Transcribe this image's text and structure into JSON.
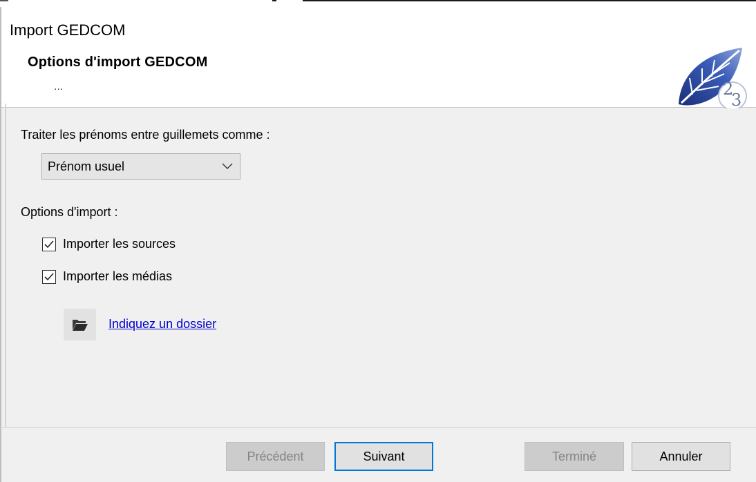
{
  "window": {
    "title": "Import GEDCOM"
  },
  "header": {
    "title": "Options d'import GEDCOM",
    "subtitle": "...",
    "logo_icon": "leaf-23-logo-icon"
  },
  "first_names": {
    "label": "Traiter les prénoms entre guillemets comme :",
    "selected": "Prénom usuel"
  },
  "import_options": {
    "label": "Options d'import :",
    "sources": {
      "label": "Importer les sources",
      "checked": true
    },
    "media": {
      "label": "Importer les médias",
      "checked": true
    },
    "folder_icon": "folder-open-icon",
    "folder_link": "Indiquez un dossier"
  },
  "footer": {
    "previous": "Précédent",
    "next": "Suivant",
    "finish": "Terminé",
    "cancel": "Annuler"
  },
  "colors": {
    "accent": "#0078d7",
    "link": "#0000cc",
    "logo_blue": "#1f3c8f"
  }
}
